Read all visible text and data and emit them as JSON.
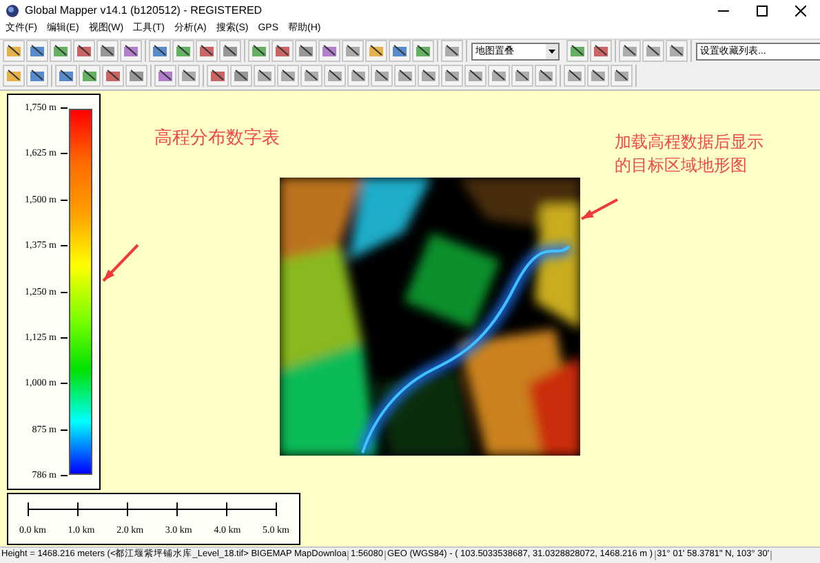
{
  "window": {
    "title": "Global Mapper v14.1 (b120512) - REGISTERED"
  },
  "menu": [
    "文件(F)",
    "编辑(E)",
    "视图(W)",
    "工具(T)",
    "分析(A)",
    "搜索(S)",
    "GPS",
    "帮助(H)"
  ],
  "toolbar": {
    "layer_combo": "地图置叠",
    "favorites_combo": "设置收藏列表..."
  },
  "legend": {
    "ticks": [
      "1,750 m",
      "1,625 m",
      "1,500 m",
      "1,375 m",
      "1,250 m",
      "1,125 m",
      "1,000 m",
      "875 m",
      "786 m"
    ]
  },
  "scale_bar": {
    "labels": [
      "0.0 km",
      "1.0 km",
      "2.0 km",
      "3.0 km",
      "4.0 km",
      "5.0 km"
    ]
  },
  "annotations": [
    {
      "text": "高程分布数字表"
    },
    {
      "text": "加载高程数据后显示的目标区域地形图"
    }
  ],
  "status_bar": [
    "Height = 1468.216 meters (<都江堰紫坪铺水库_Level_18.tif> BIGEMAP MapDownloa",
    "1:56080",
    "GEO (WGS84) - ( 103.5033538687, 31.0328828072, 1468.216 m )",
    "31° 01' 58.3781\" N, 103° 30'"
  ]
}
